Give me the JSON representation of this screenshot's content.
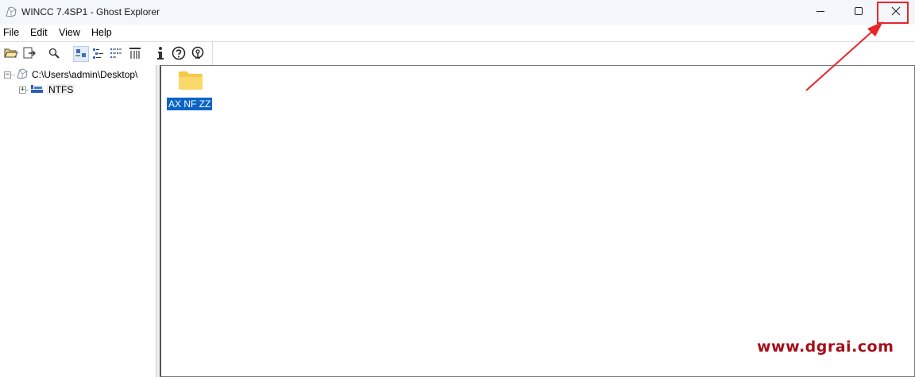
{
  "window": {
    "title": "WINCC 7.4SP1 - Ghost Explorer",
    "app_icon": "ghost-explorer-icon",
    "controls": {
      "minimize_icon": "minimize-icon",
      "maximize_icon": "maximize-icon",
      "close_icon": "close-icon"
    }
  },
  "menu": {
    "items": [
      "File",
      "Edit",
      "View",
      "Help"
    ]
  },
  "toolbar": {
    "buttons": [
      "open-folder-icon",
      "extract-icon",
      "find-icon",
      "large-icons-view-icon",
      "small-icons-view-icon",
      "list-view-icon",
      "details-view-icon",
      "info-icon",
      "help-icon",
      "web-icon"
    ],
    "pressed": "large-icons-view-icon"
  },
  "tree": {
    "root_label": "C:\\Users\\admin\\Desktop\\",
    "child_label": "NTFS"
  },
  "list": {
    "items": [
      {
        "label": "AX NF ZZ",
        "icon": "folder-icon",
        "selected": true
      }
    ]
  },
  "watermark": "www.dgrai.com",
  "colors": {
    "selection": "#0a64c8",
    "highlight_box": "#e8262a",
    "watermark": "#a4101a"
  }
}
